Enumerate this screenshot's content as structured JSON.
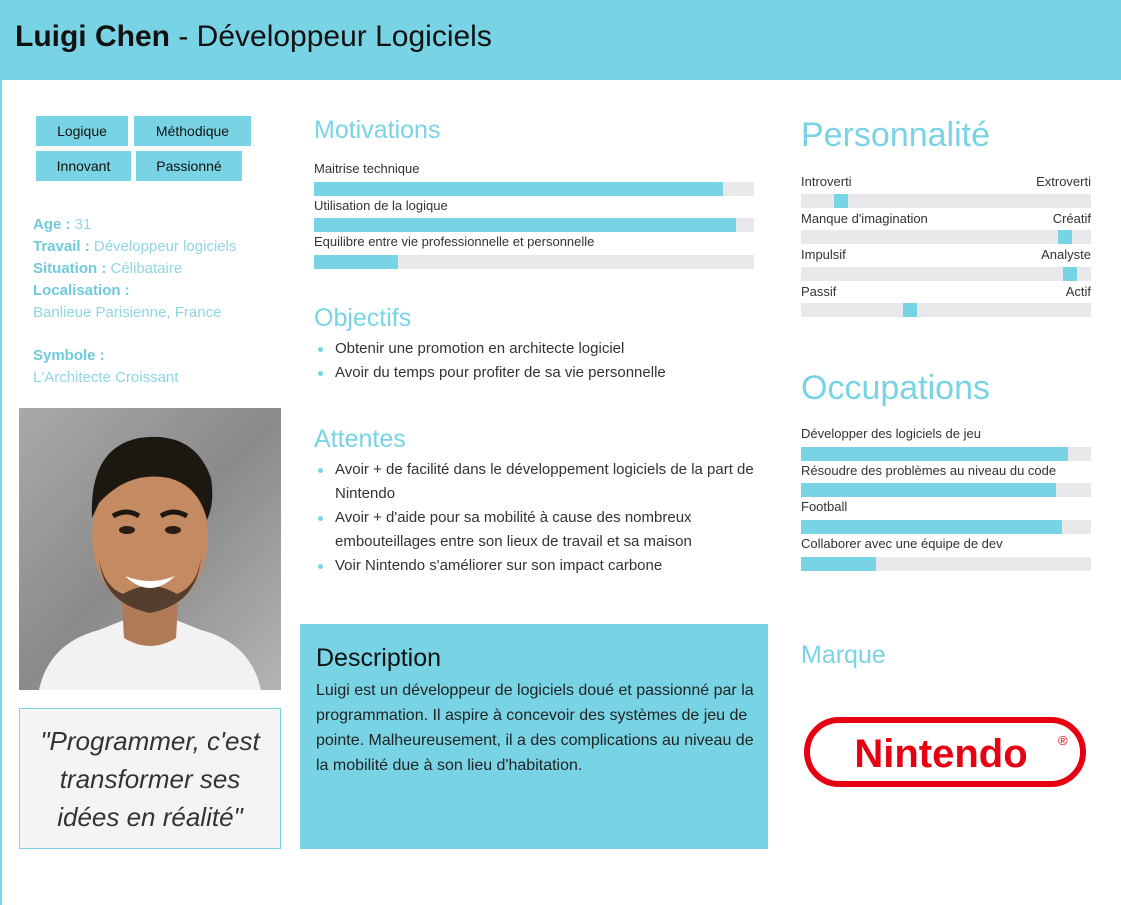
{
  "header": {
    "name": "Luigi Chen",
    "separator": " - ",
    "role": "Développeur Logiciels"
  },
  "traits": [
    "Logique",
    "Méthodique",
    "Innovant",
    "Passionné"
  ],
  "info": {
    "age_label": "Age :",
    "age_value": "31",
    "work_label": "Travail :",
    "work_value": "Développeur logiciels",
    "situation_label": "Situation :",
    "situation_value": "Célibataire",
    "location_label": "Localisation :",
    "location_value": "Banlieue Parisienne, France",
    "symbol_label": "Symbole :",
    "symbol_value": "L'Architecte Croissant"
  },
  "quote": "\"Programmer, c'est transformer ses idées en réalité\"",
  "motivations": {
    "title": "Motivations",
    "items": [
      {
        "label": "Maitrise technique",
        "level": 0.93
      },
      {
        "label": "Utilisation de la logique",
        "level": 0.96
      },
      {
        "label": "Equilibre entre vie professionnelle et personnelle",
        "level": 0.19
      }
    ]
  },
  "objectives": {
    "title": "Objectifs",
    "items": [
      "Obtenir une promotion en architecte logiciel",
      "Avoir du temps pour profiter de sa vie personnelle"
    ]
  },
  "expectations": {
    "title": "Attentes",
    "items": [
      "Avoir + de facilité dans le développement logiciels de la part de Nintendo",
      "Avoir + d'aide pour sa mobilité à cause des nombreux embouteillages entre son lieux de travail et sa maison",
      "Voir Nintendo s'améliorer sur son impact carbone"
    ]
  },
  "description": {
    "title": "Description",
    "text": "Luigi est un développeur de logiciels doué et passionné par la programmation. Il aspire à concevoir des systèmes de jeu de pointe. Malheureusement, il a des complications au niveau de la mobilité due à son lieu d'habitation."
  },
  "personality": {
    "title": "Personnalité",
    "items": [
      {
        "left": "Introverti",
        "right": "Extroverti",
        "level": 0.12
      },
      {
        "left": "Manque d'imagination",
        "right": "Créatif",
        "level": 0.93
      },
      {
        "left": "Impulsif",
        "right": "Analyste",
        "level": 0.95
      },
      {
        "left": "Passif",
        "right": "Actif",
        "level": 0.37
      }
    ]
  },
  "occupations": {
    "title": "Occupations",
    "items": [
      {
        "label": "Développer des logiciels de jeu",
        "level": 0.92
      },
      {
        "label": "Résoudre des problèmes au niveau du code",
        "level": 0.88
      },
      {
        "label": "Football",
        "level": 0.9
      },
      {
        "label": "Collaborer avec une équipe de dev",
        "level": 0.26
      }
    ]
  },
  "brand": {
    "title": "Marque",
    "logo_text": "Nintendo",
    "logo_mark": "®"
  },
  "colors": {
    "accent": "#78d4e4",
    "track": "#e9e9eb",
    "logo_red": "#e60012"
  }
}
